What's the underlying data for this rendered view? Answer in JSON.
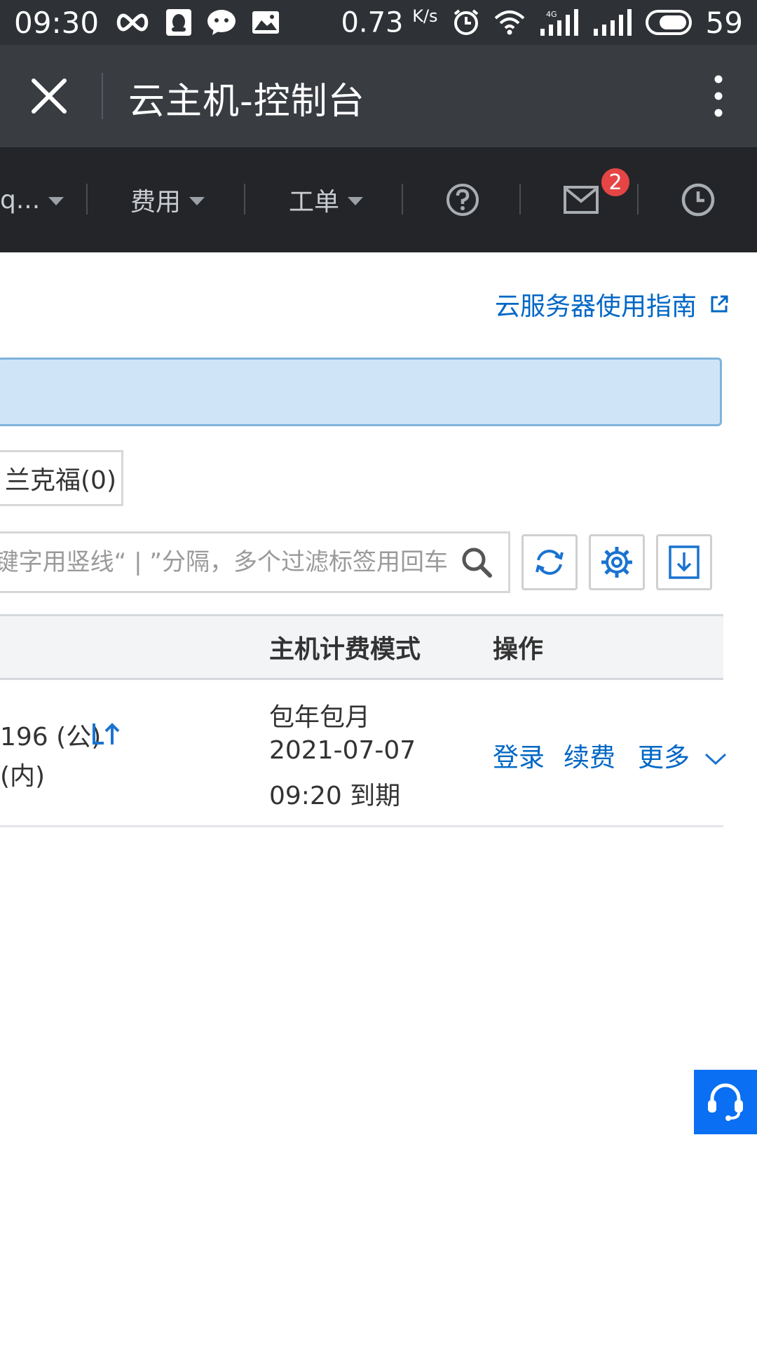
{
  "status_bar": {
    "time": "09:30",
    "net_speed": "0.73",
    "net_speed_unit": "K/s",
    "battery": "59",
    "icons": [
      "infinity-icon",
      "qq-icon",
      "wechat-icon",
      "image-icon",
      "alarm-icon",
      "wifi-icon",
      "signal-4g-icon",
      "signal-icon",
      "battery-icon"
    ]
  },
  "titlebar": {
    "title": "云主机-控制台"
  },
  "top_nav": {
    "items": [
      {
        "label": "q..."
      },
      {
        "label": "费用"
      },
      {
        "label": "工单"
      }
    ],
    "mail_badge": "2"
  },
  "content": {
    "guide_link": "云服务器使用指南",
    "region_tab": "兰克福(0)",
    "search": {
      "placeholder": "多个关键字用竖线“ | ”分隔，多个过滤标签用回车"
    },
    "table": {
      "headers": [
        "主机计费模式",
        "操作"
      ],
      "rows": [
        {
          "ip_public": "196 (公)",
          "ip_private": "(内)",
          "billing_line1": "包年包月",
          "billing_line2": "2021-07-07",
          "billing_line3": "09:20 到期",
          "actions": [
            "登录",
            "续费",
            "更多"
          ]
        }
      ]
    }
  },
  "colors": {
    "accent": "#0067c5",
    "status_bar_bg": "#2e3135",
    "titlebar_bg": "#393d42",
    "nav_bg": "#232528",
    "badge": "#e54545",
    "notice_bg": "#cfe5f7",
    "fab": "#0a6ff3"
  }
}
